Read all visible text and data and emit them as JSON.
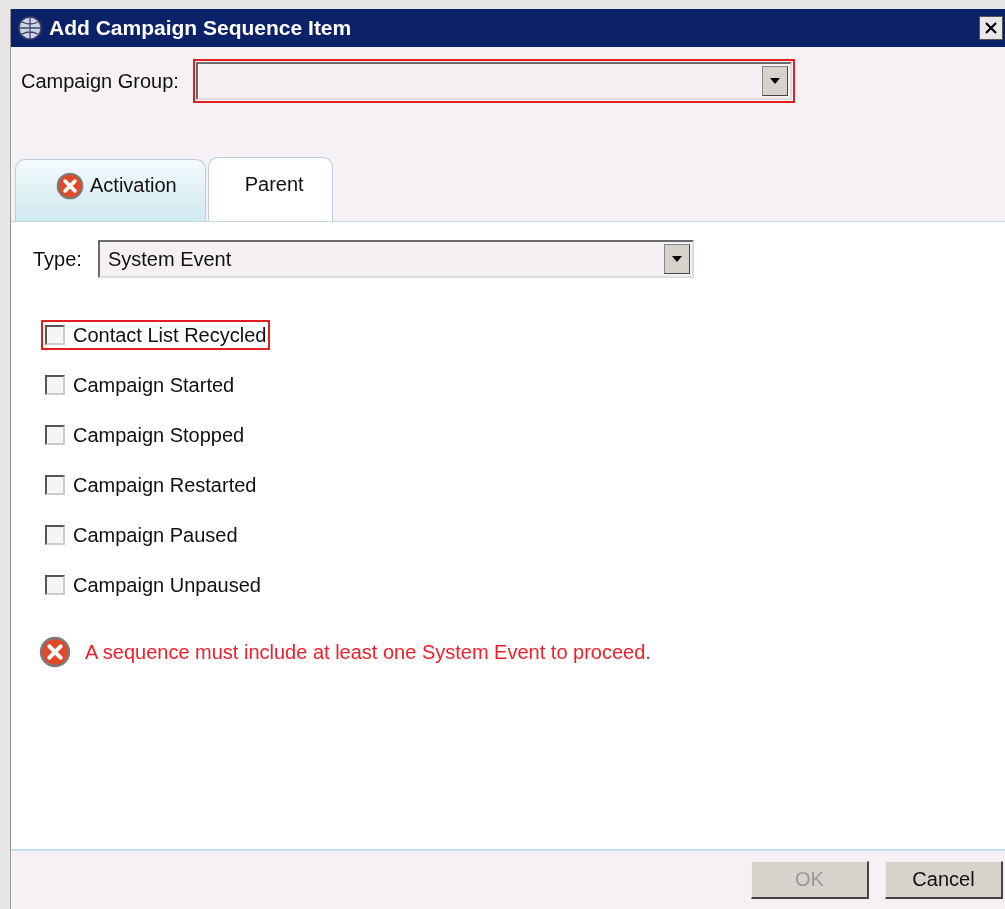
{
  "window": {
    "title": "Add Campaign Sequence Item"
  },
  "campaign_group": {
    "label": "Campaign Group:",
    "invalid": true
  },
  "tabs": [
    {
      "label": "Activation",
      "selected": false,
      "error": true
    },
    {
      "label": "Parent",
      "selected": true,
      "error": false
    }
  ],
  "type": {
    "label": "Type:",
    "value": "System Event"
  },
  "events": [
    {
      "label": "Contact List Recycled",
      "checked": false,
      "invalid": true
    },
    {
      "label": "Campaign Started",
      "checked": false,
      "invalid": false
    },
    {
      "label": "Campaign Stopped",
      "checked": false,
      "invalid": false
    },
    {
      "label": "Campaign Restarted",
      "checked": false,
      "invalid": false
    },
    {
      "label": "Campaign Paused",
      "checked": false,
      "invalid": false
    },
    {
      "label": "Campaign Unpaused",
      "checked": false,
      "invalid": false
    }
  ],
  "error_message": "A sequence must include at least one System Event to proceed.",
  "buttons": [
    {
      "label": "OK",
      "disabled": true
    },
    {
      "label": "Cancel",
      "disabled": false
    }
  ]
}
